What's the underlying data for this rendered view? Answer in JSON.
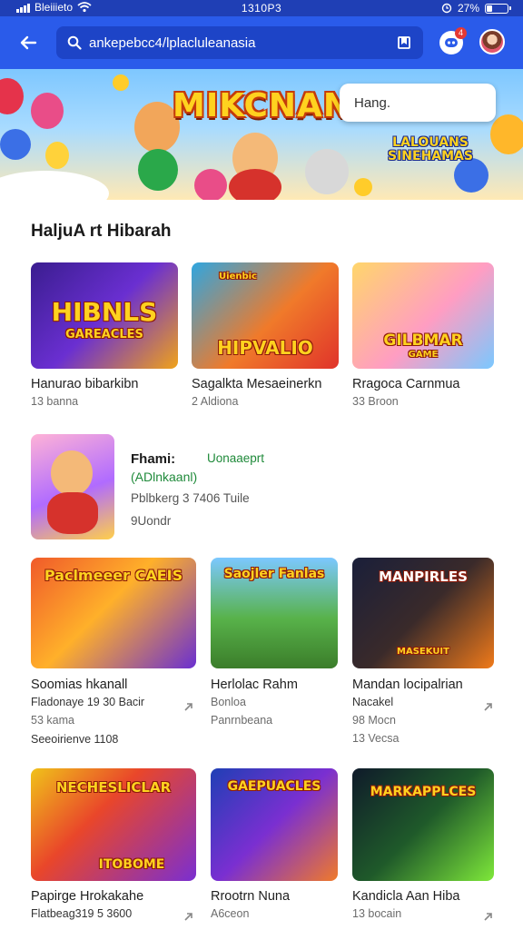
{
  "status_bar": {
    "carrier": "Bleiiieto",
    "time": "1310P3",
    "battery": "27%",
    "battery_level": 0.27
  },
  "search": {
    "value": "ankepebcc4/lplacluleanasia",
    "placeholder": "ankepebcc4/lplacluleanasia"
  },
  "notifications": {
    "count": "4"
  },
  "hero": {
    "title": "MIKCNANH",
    "subtitle": "LALOUANS SINEHAMAS",
    "popup": "Hang."
  },
  "section": {
    "title": "HaljuA rt Hibarah"
  },
  "row1": [
    {
      "art": "HIBNLS",
      "art_sub": "GAREACLES",
      "title": "Hanurao bibarkibn",
      "meta": "13 banna"
    },
    {
      "art": "HIPVALIO",
      "art_sub": "Uienbic",
      "title": "Sagalkta Mesaeinerkn",
      "meta": "2 Aldiona"
    },
    {
      "art": "GILBMAR",
      "art_sub": "GAME",
      "title": "Rragoca Carnmua",
      "meta": "33 Broon"
    }
  ],
  "featured": {
    "name": "Fhami:",
    "badge": "Uonaaeprt",
    "developer": "(ADlnkaanl)",
    "info": "Pblbkerg 3 7406 Tuile",
    "rating": "9Uondr"
  },
  "row2": [
    {
      "art": "Paclmeeer CAEIS",
      "title": "Soomias hkanall",
      "meta1": "Fladonaye 19 30 Bacir",
      "meta2": "53 kama",
      "meta3": "Seeoirienve 1108"
    },
    {
      "art": "Saojler Fanlas",
      "title": "Herlolac Rahm",
      "meta1": "Bonloa",
      "meta2": "Panrnbeana"
    },
    {
      "art": "MANPIRLES",
      "art_sub": "MASEKUIT",
      "title": "Mandan locipalrian",
      "meta1": "Nacakel",
      "meta2": "98 Mocn",
      "meta3": "13 Vecsa"
    }
  ],
  "row3": [
    {
      "art": "NECHESLICLAR",
      "art_sub": "ITOBOME",
      "title": "Papirge Hrokakahe",
      "meta1": "Flatbeag319 5 3600"
    },
    {
      "art": "GAEPUACLES",
      "title": "Rrootrn Nuna",
      "meta1": "A6ceon"
    },
    {
      "art": "MARKAPPLCES",
      "title": "Kandicla Aan Hiba",
      "meta1": "13 bocain"
    }
  ],
  "colors": {
    "status_bar": "#1f3fb5",
    "app_bar": "#2a5bea",
    "search_box": "#1d44c7",
    "link_green": "#1f8a3a",
    "badge_red": "#e53935"
  },
  "icons": [
    "signal-icon",
    "wifi-icon",
    "alarm-icon",
    "battery-icon",
    "back-arrow-icon",
    "search-icon",
    "bookmark-icon",
    "notification-icon",
    "avatar",
    "share-arrow-icon"
  ]
}
